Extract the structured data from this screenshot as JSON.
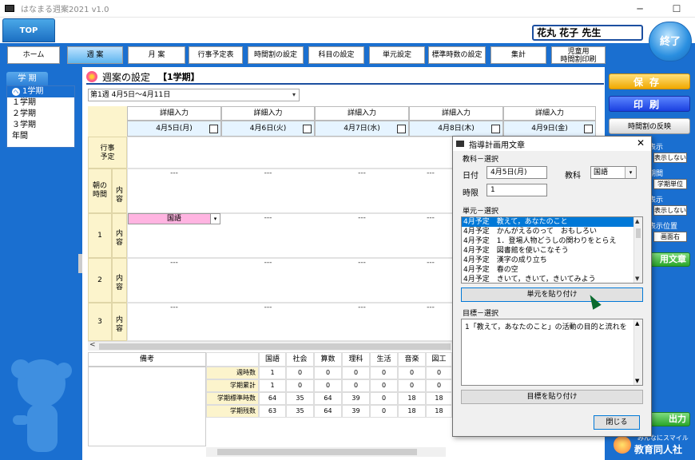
{
  "window": {
    "title": "はなまる週案2021 v1.0",
    "minimize": "─",
    "maximize": "☐"
  },
  "top": {
    "top_label": "TOP",
    "teacher": "花丸 花子 先生",
    "end_label": "終了"
  },
  "nav": [
    {
      "label": "ホーム"
    },
    {
      "label": "週 案"
    },
    {
      "label": "月 案"
    },
    {
      "label": "行事予定表"
    },
    {
      "label": "時間割の設定"
    },
    {
      "label": "科目の設定"
    },
    {
      "label": "単元設定"
    },
    {
      "label": "標準時数の設定"
    },
    {
      "label": "集計"
    },
    {
      "label1": "児童用",
      "label2": "時間割印刷"
    }
  ],
  "terms": {
    "tab": "学 期",
    "selected_mark": "へ",
    "items": [
      "1学期",
      "１学期",
      "２学期",
      "３学期",
      "年間"
    ]
  },
  "page": {
    "title": "週案の設定",
    "term": "【1学期】",
    "week": "第1週 4月5日～4月11日",
    "dropdown_arrow": "▾"
  },
  "days": [
    {
      "head": "詳細入力",
      "date": "4月5日(月)"
    },
    {
      "head": "詳細入力",
      "date": "4月6日(火)"
    },
    {
      "head": "詳細入力",
      "date": "4月7日(水)"
    },
    {
      "head": "詳細入力",
      "date": "4月8日(木)"
    },
    {
      "head": "詳細入力",
      "date": "4月9日(金)"
    }
  ],
  "rows": {
    "event_l1": "行事",
    "event_l2": "予定",
    "morning_l1": "朝の",
    "morning_l2": "時間",
    "content": "内容",
    "p1": "1",
    "p2": "2",
    "p3": "3",
    "dash": "---",
    "subject": "国語",
    "arrow": "▾"
  },
  "scroll_left": "<",
  "remarks": {
    "head": "備考"
  },
  "stats": {
    "subjects": [
      "国語",
      "社会",
      "算数",
      "理科",
      "生活",
      "音楽",
      "図工"
    ],
    "rows": [
      {
        "label": "週時数",
        "values": [
          "1",
          "0",
          "0",
          "0",
          "0",
          "0",
          "0"
        ]
      },
      {
        "label": "学期累計",
        "values": [
          "1",
          "0",
          "0",
          "0",
          "0",
          "0",
          "0"
        ]
      },
      {
        "label": "学期標準時数",
        "values": [
          "64",
          "35",
          "64",
          "39",
          "0",
          "18",
          "18"
        ]
      },
      {
        "label": "学期残数",
        "values": [
          "63",
          "35",
          "64",
          "39",
          "0",
          "18",
          "18"
        ]
      }
    ]
  },
  "right": {
    "save": "保存",
    "print": "印刷",
    "reflect": "時間割の反映",
    "display1": "表示",
    "hide1": "表示しない",
    "period": "期間",
    "period_btn": "学期単位",
    "display2": "表示",
    "hide2": "表示しない",
    "display_pos": "表示位置",
    "pos_btn": "画面右",
    "guide": "用文章",
    "output": "出力"
  },
  "logo": {
    "line1": "みんなにスマイル",
    "line2": "教育同人社"
  },
  "dialog": {
    "title": "指導計画用文章",
    "close_x": "✕",
    "subject_section": "教科－選択",
    "date_label": "日付",
    "date_value": "4月5日(月)",
    "subject_label": "教科",
    "subject_value": "国語",
    "period_label": "時限",
    "period_value": "1",
    "unit_section": "単元－選択",
    "units": [
      "4月予定　教えて，あなたのこと",
      "4月予定　かんがえるのって　おもしろい",
      "4月予定　1．登場人物どうしの関わりをとらえ",
      "4月予定　図書館を使いこなそう",
      "4月予定　漢字の成り立ち",
      "4月予定　春の空",
      "4月予定　きいて，きいて，きいてみよう"
    ],
    "paste_unit": "単元を貼り付け",
    "goal_section": "目標－選択",
    "goal_text": "1「教えて，あなたのこと」の活動の目的と流れを",
    "paste_goal": "目標を貼り付け",
    "close_btn": "閉じる",
    "up": "▲",
    "down": "▼",
    "left": "<",
    "right": ">"
  }
}
